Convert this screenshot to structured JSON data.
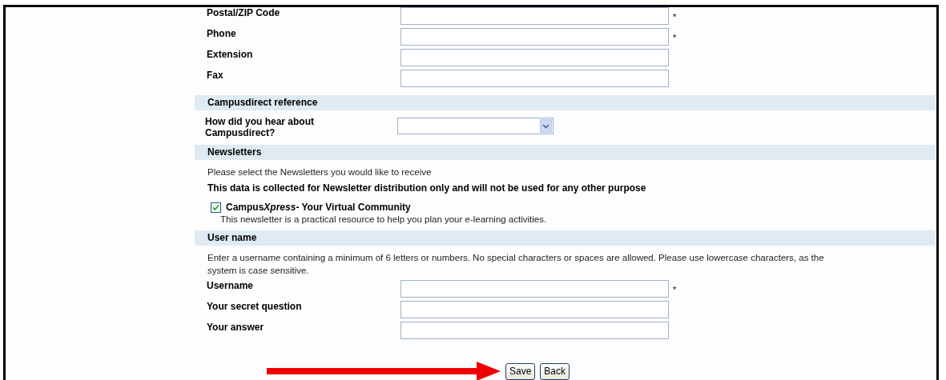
{
  "blocks": [
    {
      "kind": "field",
      "label": "Postal/ZIP Code",
      "required_mark": "*"
    },
    {
      "kind": "field",
      "label": "Phone",
      "required_mark": "*"
    },
    {
      "kind": "field",
      "label": "Extension"
    },
    {
      "kind": "field",
      "label": "Fax"
    },
    {
      "kind": "heading",
      "label": "Campusdirect reference"
    },
    {
      "kind": "select",
      "label": "How did you hear about Campusdirect?"
    },
    {
      "kind": "heading",
      "label": "Newsletters"
    },
    {
      "kind": "text",
      "label": "Please select the Newsletters you would like to receive"
    },
    {
      "kind": "notice",
      "label": "This data is collected for Newsletter distribution only and will not be used for any other purpose"
    },
    {
      "kind": "checkbox",
      "label": "Campus",
      "label_italic": "Xpress",
      "label_rest": "- Your Virtual Community",
      "checked": true,
      "description": "This newsletter is a practical resource to help you plan your e-learning activities."
    },
    {
      "kind": "heading",
      "label": "User name"
    },
    {
      "kind": "text",
      "label": "Enter a username containing a minimum of 6 letters or numbers. No special characters or spaces are allowed. Please use lowercase characters, as the system is case sensitive."
    },
    {
      "kind": "field",
      "label": "Username",
      "required_mark": "*"
    },
    {
      "kind": "field",
      "label": "Your secret question"
    },
    {
      "kind": "field",
      "label": "Your answer"
    }
  ],
  "buttons": [
    "Save",
    "Back"
  ]
}
